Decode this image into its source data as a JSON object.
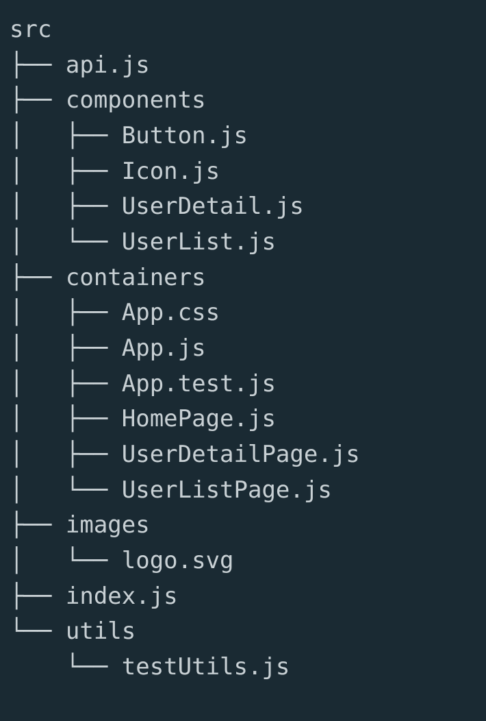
{
  "tree": {
    "root": "src",
    "lines": [
      "├── api.js",
      "├── components",
      "│   ├── Button.js",
      "│   ├── Icon.js",
      "│   ├── UserDetail.js",
      "│   └── UserList.js",
      "├── containers",
      "│   ├── App.css",
      "│   ├── App.js",
      "│   ├── App.test.js",
      "│   ├── HomePage.js",
      "│   ├── UserDetailPage.js",
      "│   └── UserListPage.js",
      "├── images",
      "│   └── logo.svg",
      "├── index.js",
      "└── utils",
      "    └── testUtils.js"
    ]
  }
}
